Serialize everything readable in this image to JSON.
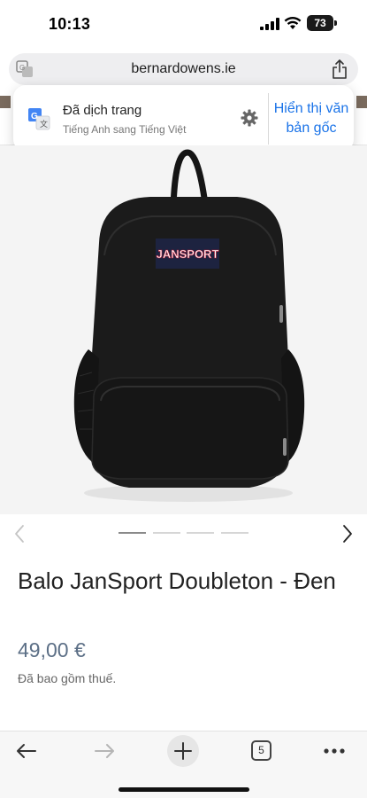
{
  "status_bar": {
    "time": "10:13",
    "battery_level": "73"
  },
  "address_bar": {
    "url": "bernardowens.ie",
    "translate_icon": "translate-icon",
    "share_icon": "share-icon"
  },
  "translation_popup": {
    "title": "Đã dịch trang",
    "subtitle": "Tiếng Anh sang Tiếng Việt",
    "show_original_label": "Hiển thị văn bản gốc",
    "accent_color": "#1a73e8"
  },
  "product": {
    "image_label": "JANSPORT",
    "title": "Balo JanSport Doubleton - Đen",
    "price": "49,00 €",
    "tax_note": "Đã bao gồm thuế.",
    "price_color": "#5c6f86"
  },
  "carousel": {
    "slide_count": 4,
    "active_index": 0
  },
  "toolbar": {
    "tab_count": "5"
  }
}
